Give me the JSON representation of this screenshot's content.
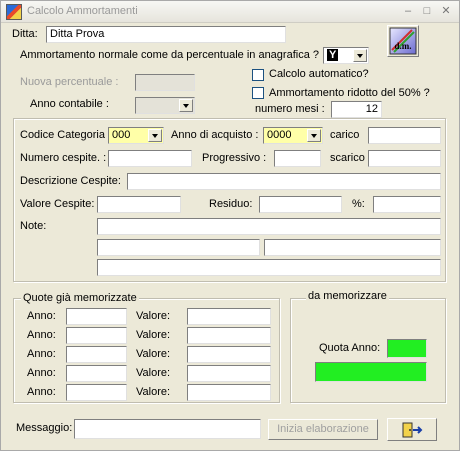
{
  "window": {
    "title": "Calcolo Ammortamenti",
    "minimize_glyph": "–",
    "restore_glyph": "□",
    "close_glyph": "✕"
  },
  "header": {
    "ditta_label": "Ditta:",
    "ditta_value": "Ditta Prova",
    "ammortamento_label": "Ammortamento normale come  da percentuale in anagrafica ? :",
    "ammortamento_value": "Y",
    "nuova_percentuale_label": "Nuova percentuale :",
    "nuova_percentuale_value": "",
    "anno_contabile_label": "Anno contabile :",
    "anno_contabile_value": "",
    "calcolo_automatico_label": "Calcolo automatico?",
    "ammortamento_ridotto_label": "Ammortamento ridotto del 50% ?",
    "numero_mesi_label": "numero mesi :",
    "numero_mesi_value": "12",
    "logo_text": "d.m."
  },
  "cespite": {
    "codice_categoria_label": "Codice Categoria",
    "codice_categoria_value": "000",
    "anno_acquisto_label": "Anno di acquisto :",
    "anno_acquisto_value": "0000",
    "carico_label": "carico",
    "carico_value": "",
    "numero_cespite_label": "Numero cespite. :",
    "numero_cespite_value": "",
    "progressivo_label": "Progressivo :",
    "progressivo_value": "",
    "scarico_label": "scarico",
    "scarico_value": "",
    "descrizione_label": "Descrizione Cespite:",
    "descrizione_value": "",
    "valore_label": "Valore Cespite:",
    "valore_value": "",
    "residuo_label": "Residuo:",
    "residuo_value": "",
    "percent_label": "%:",
    "percent_value": "",
    "note_label": "Note:"
  },
  "quote": {
    "title": "Quote già memorizzate",
    "anno_label": "Anno:",
    "valore_label": "Valore:",
    "rows": [
      {
        "anno": "",
        "valore": ""
      },
      {
        "anno": "",
        "valore": ""
      },
      {
        "anno": "",
        "valore": ""
      },
      {
        "anno": "",
        "valore": ""
      },
      {
        "anno": "",
        "valore": ""
      }
    ]
  },
  "da_memorizzare": {
    "title": "da memorizzare",
    "quota_anno_label": "Quota Anno:",
    "quota_anno_value": "",
    "valore_value": "",
    "indicator_color": "#22ee22"
  },
  "footer": {
    "messaggio_label": "Messaggio:",
    "messaggio_value": "",
    "inizia_button": "Inizia elaborazione",
    "exit_icon": "exit-door-icon"
  }
}
